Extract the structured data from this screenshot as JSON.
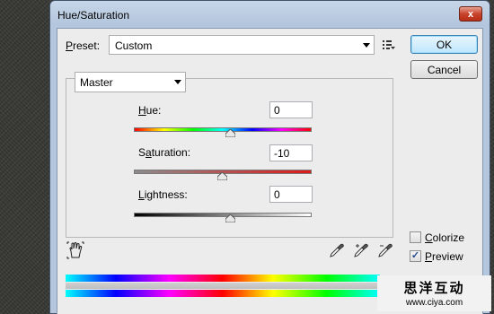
{
  "window": {
    "title": "Hue/Saturation",
    "close_glyph": "x"
  },
  "preset": {
    "label": "Preset:",
    "value": "Custom"
  },
  "buttons": {
    "ok": "OK",
    "cancel": "Cancel"
  },
  "channel": {
    "value": "Master"
  },
  "sliders": {
    "hue": {
      "label": "Hue:",
      "value": "0"
    },
    "saturation": {
      "label": "Saturation:",
      "value": "-10"
    },
    "lightness": {
      "label": "Lightness:",
      "value": "0"
    }
  },
  "options": {
    "colorize": {
      "label": "Colorize",
      "checked": false
    },
    "preview": {
      "label": "Preview",
      "checked": true
    }
  },
  "watermark": {
    "title": "思洋互动",
    "url": "www.ciya.com"
  },
  "icons": {
    "preset_menu": "preset-menu-icon",
    "hand": "targeted-adjustment-hand-icon",
    "eyedropper": "eyedropper-icon",
    "eyedropper_add": "eyedropper-plus-icon",
    "eyedropper_subtract": "eyedropper-minus-icon"
  },
  "colors": {
    "title_bar": "#b3c6dd",
    "dialog_bg": "#ececec",
    "close_button": "#c8442c",
    "ok_button_border": "#3c7fb1"
  }
}
